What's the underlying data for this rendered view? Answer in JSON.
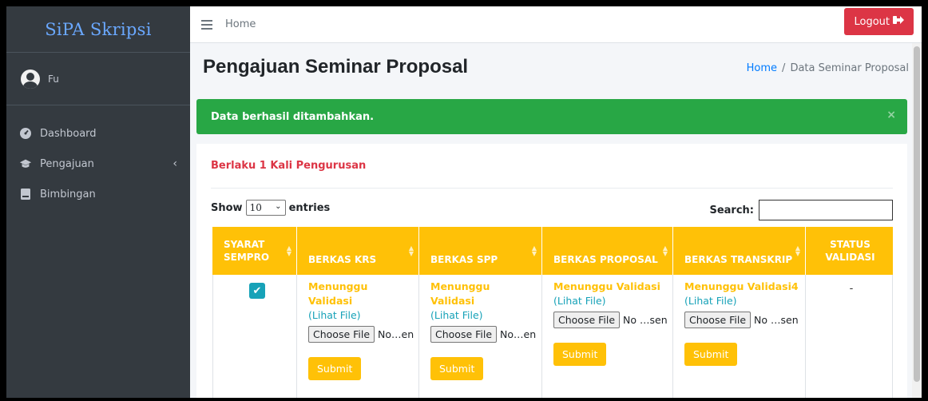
{
  "sidebar": {
    "brand": "SiPA Skripsi",
    "user": "Fu",
    "items": [
      {
        "label": "Dashboard",
        "icon": "tachometer-icon"
      },
      {
        "label": "Pengajuan",
        "icon": "graduation-cap-icon"
      },
      {
        "label": "Bimbingan",
        "icon": "book-icon"
      }
    ]
  },
  "topbar": {
    "home": "Home",
    "logout": "Logout"
  },
  "header": {
    "title": "Pengajuan Seminar Proposal"
  },
  "breadcrumb": {
    "home": "Home",
    "separator": "/",
    "current": "Data Seminar Proposal"
  },
  "alert": {
    "message": "Data berhasil ditambahkan.",
    "close": "×"
  },
  "card": {
    "title": "Berlaku 1 Kali Pengurusan"
  },
  "datatable": {
    "show": "Show",
    "entries_value": "10",
    "entries": "entries",
    "search_label": "Search:"
  },
  "table": {
    "headers": [
      "SYARAT SEMPRO",
      "BERKAS KRS",
      "BERKAS SPP",
      "BERKAS PROPOSAL",
      "BERKAS TRANSKRIP",
      "STATUS VALIDASI"
    ],
    "row": {
      "krs": {
        "status": "Menunggu Validasi",
        "link": "(Lihat File)",
        "choose": "Choose File",
        "file": "No…en",
        "submit": "Submit"
      },
      "spp": {
        "status": "Menunggu Validasi",
        "link": "(Lihat File)",
        "choose": "Choose File",
        "file": "No…en",
        "submit": "Submit"
      },
      "proposal": {
        "status": "Menunggu Validasi",
        "link": "(Lihat File)",
        "choose": "Choose File",
        "file": "No …sen",
        "submit": "Submit"
      },
      "transkrip": {
        "status": "Menunggu Validasi4",
        "link": "(Lihat File)",
        "choose": "Choose File",
        "file": "No …sen",
        "submit": "Submit"
      },
      "validasi": "-"
    }
  },
  "colors": {
    "sidebar": "#343a40",
    "brand": "#6aa8ff",
    "header": "#ffc107",
    "alert": "#28a745",
    "logout": "#dc3545",
    "link": "#17a2b8"
  }
}
